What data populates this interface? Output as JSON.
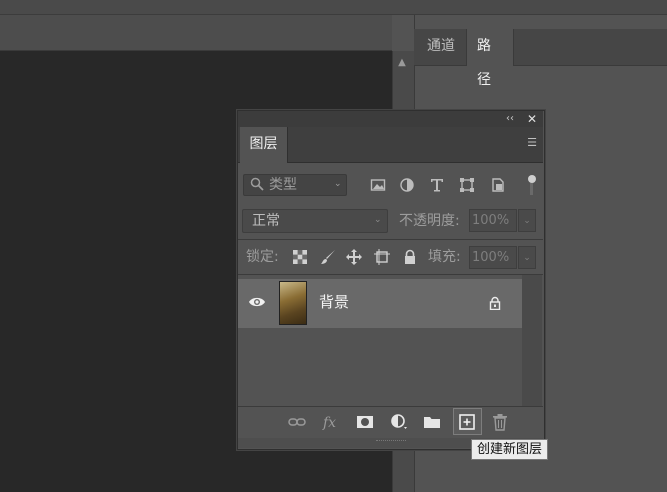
{
  "dock": {
    "tabs": [
      {
        "label": "通道",
        "active": false
      },
      {
        "label": "路径",
        "active": true
      }
    ]
  },
  "layers_panel": {
    "tab_label": "图层",
    "filter": {
      "kind_label": "类型",
      "icons": [
        "image-filter-icon",
        "adjustment-filter-icon",
        "type-filter-icon",
        "shape-filter-icon",
        "smart-object-filter-icon"
      ]
    },
    "blend_mode": "正常",
    "opacity_label": "不透明度:",
    "opacity_value": "100%",
    "lock_label": "锁定:",
    "fill_label": "填充:",
    "fill_value": "100%",
    "layers": [
      {
        "name": "背景",
        "visible": true,
        "locked": true
      }
    ],
    "bottom_tools": [
      "link-layers-icon",
      "fx-icon",
      "add-mask-icon",
      "adjustment-layer-icon",
      "new-group-icon",
      "new-layer-icon",
      "delete-layer-icon"
    ],
    "tooltip": "创建新图层"
  },
  "colors": {
    "canvas": "#282828",
    "panel": "#535353",
    "selected_row": "#696969"
  }
}
